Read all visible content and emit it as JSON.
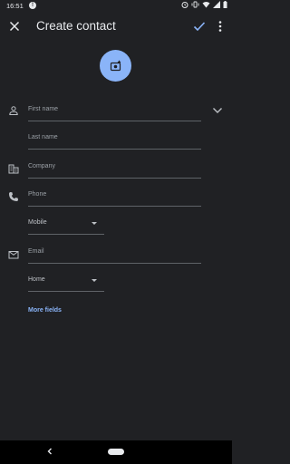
{
  "status_bar": {
    "time": "16:51",
    "alert_badge": "!",
    "icons": [
      "alarm-icon",
      "vibrate-icon",
      "wifi-icon",
      "signal-icon",
      "battery-icon"
    ]
  },
  "app_bar": {
    "title": "Create contact",
    "close_icon": "close-icon",
    "save_icon": "check-icon",
    "more_icon": "more-vert-icon"
  },
  "photo": {
    "icon": "add-photo-icon"
  },
  "form": {
    "first_name_placeholder": "First name",
    "last_name_placeholder": "Last name",
    "company_placeholder": "Company",
    "phone_placeholder": "Phone",
    "phone_type": "Mobile",
    "email_placeholder": "Email",
    "email_type": "Home",
    "more_fields": "More fields"
  },
  "colors": {
    "background": "#202124",
    "accent": "#8ab4f8",
    "text": "#e8eaed",
    "hint": "#9aa0a6",
    "divider": "#5f6368"
  }
}
